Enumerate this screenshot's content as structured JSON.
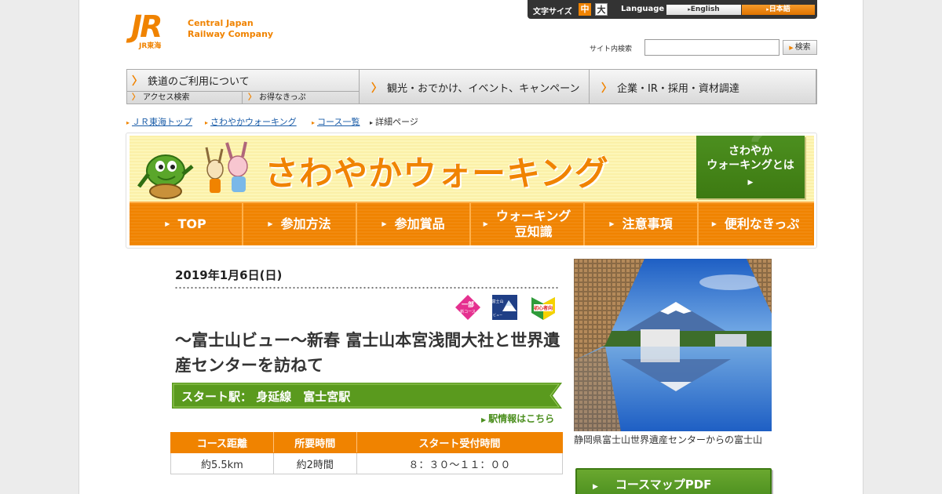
{
  "header": {
    "logo_mark": "JR",
    "logo_sub": "JR東海",
    "company_line1": "Central Japan",
    "company_line2": "Railway Company"
  },
  "utility": {
    "font_size_label": "文字サイズ",
    "font_mid": "中",
    "font_large": "大",
    "language_label": "Language",
    "english": "English",
    "japanese": "日本語"
  },
  "search": {
    "label": "サイト内検索",
    "placeholder": "",
    "button": "検索"
  },
  "gnav": {
    "rail_use": "鉄道のご利用について",
    "access_search": "アクセス検索",
    "deal_tickets": "お得なきっぷ",
    "tourism": "観光・おでかけ、イベント、キャンペーン",
    "corporate": "企業・IR・採用・資材調達"
  },
  "breadcrumb": {
    "top": "ＪＲ東海トップ",
    "walking": "さわやかウォーキング",
    "course_list": "コース一覧",
    "current": "詳細ページ"
  },
  "banner": {
    "title": "さわやかウォーキング",
    "about_line1": "さわやか",
    "about_line2": "ウォーキングとは",
    "menu": [
      "TOP",
      "参加方法",
      "参加賞品",
      "ウォーキング",
      "注意事項",
      "便利なきっぷ"
    ],
    "menu_sub": "豆知識"
  },
  "event": {
    "date": "2019年1月6日(日)",
    "badge1_line1": "一部",
    "badge1_line2": "新コース",
    "badge2_line1": "富士山",
    "badge2_line2": "ビュー",
    "badge3": "初心者向",
    "title": "～富士山ビュー～新春 富士山本宮浅間大社と世界遺産センターを訪ねて",
    "start_station": "スタート駅：  身延線　富士宮駅",
    "station_info_link": "駅情報はこちら",
    "table_headers": [
      "コース距離",
      "所要時間",
      "スタート受付時間"
    ],
    "table_values": [
      "約5.5km",
      "約2時間",
      "８：３０～１１：００"
    ]
  },
  "side": {
    "photo_caption": "静岡県富士山世界遺産センターからの富士山",
    "pdf_button": "コースマップPDF"
  },
  "colors": {
    "brand_orange": "#f08300",
    "walking_green": "#4c8f1f",
    "link_blue": "#1a5ca8"
  }
}
